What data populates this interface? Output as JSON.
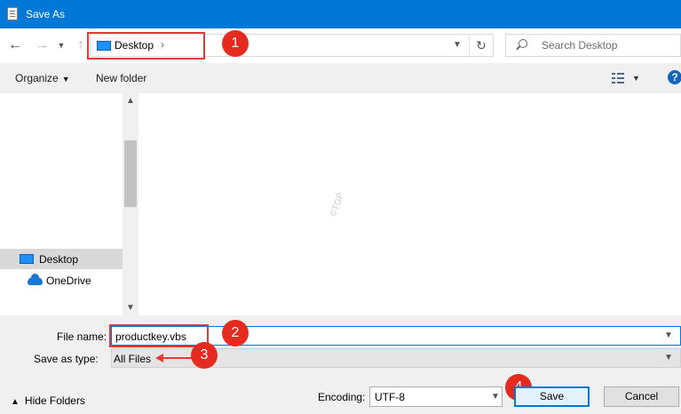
{
  "window": {
    "title": "Save As"
  },
  "address": {
    "location": "Desktop",
    "breadcrumb_chevron": "›"
  },
  "search": {
    "placeholder": "Search Desktop"
  },
  "toolbar": {
    "organize_label": "Organize",
    "new_folder_label": "New folder",
    "help_label": "?"
  },
  "nav_pane": {
    "items": [
      {
        "label": "Desktop",
        "icon": "desktop-icon",
        "selected": true
      },
      {
        "label": "OneDrive",
        "icon": "onedrive-icon",
        "selected": false
      }
    ]
  },
  "content": {
    "watermark": "©TGP"
  },
  "form": {
    "file_name_label": "File name:",
    "file_name_value": "productkey.vbs",
    "save_type_label": "Save as type:",
    "save_type_value": "All Files",
    "encoding_label": "Encoding:",
    "encoding_value": "UTF-8"
  },
  "footer": {
    "hide_folders_label": "Hide Folders"
  },
  "buttons": {
    "save_label": "Save",
    "cancel_label": "Cancel"
  },
  "annotations": {
    "callout_1": "1",
    "callout_2": "2",
    "callout_3": "3",
    "callout_4": "4"
  },
  "colors": {
    "titlebar": "#0078d7",
    "annotation_red": "#e53935",
    "focus_blue": "#0078d7"
  }
}
